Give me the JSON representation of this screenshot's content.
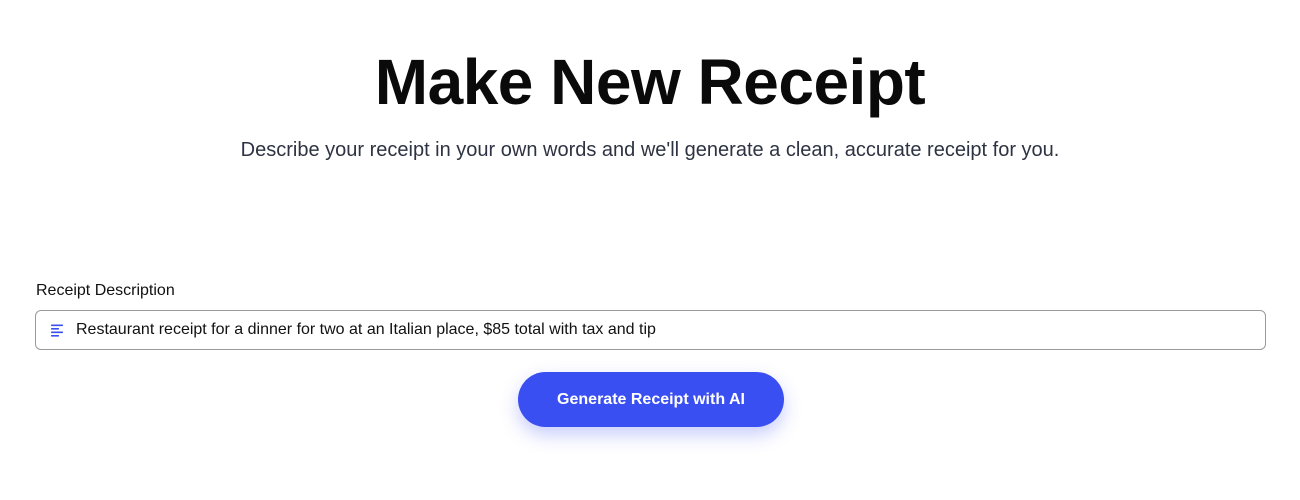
{
  "header": {
    "title": "Make New Receipt",
    "subtitle": "Describe your receipt in your own words and we'll generate a clean, accurate receipt for you."
  },
  "form": {
    "label": "Receipt Description",
    "input_value": "Restaurant receipt for a dinner for two at an Italian place, $85 total with tax and tip",
    "input_icon": "text-align-left-icon",
    "button_label": "Generate Receipt with AI"
  },
  "colors": {
    "accent": "#3a4ff2",
    "icon": "#3a4ff2",
    "input_border": "#9a9a9a"
  }
}
